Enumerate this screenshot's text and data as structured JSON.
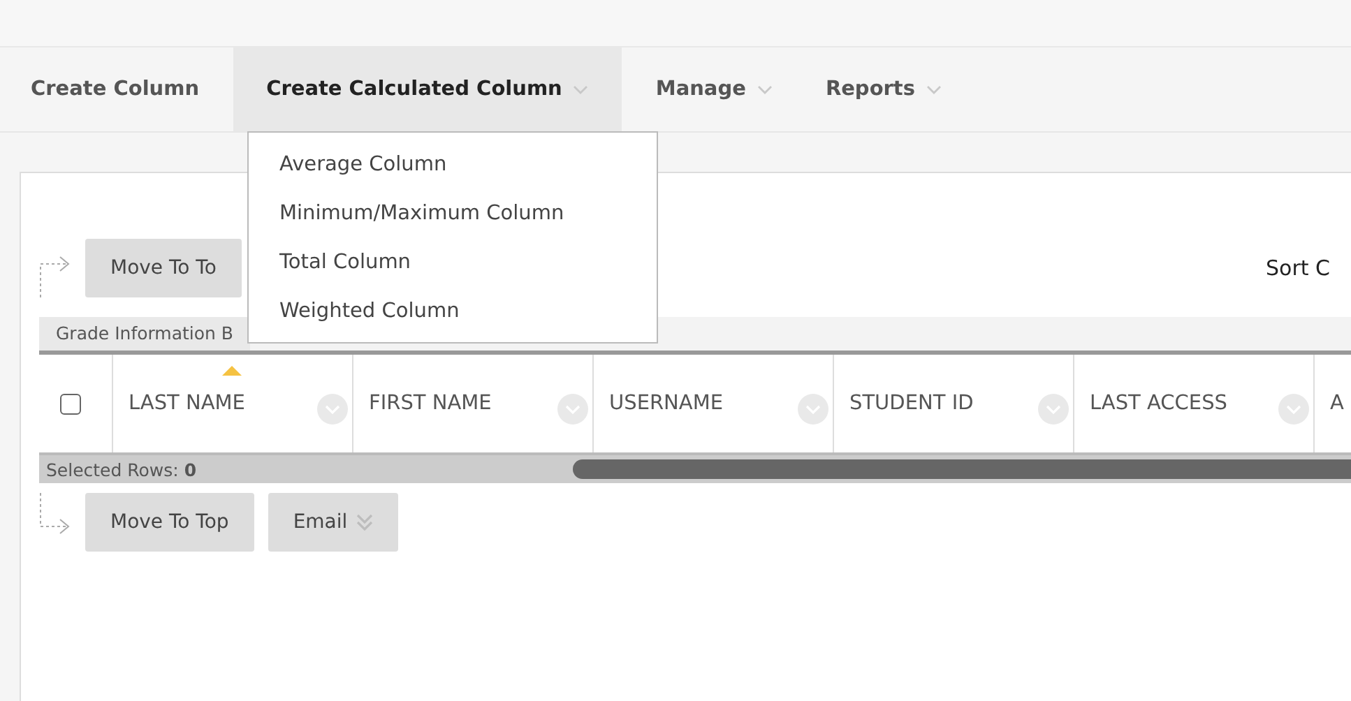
{
  "nav": [
    {
      "label": "Create Column",
      "selected": false,
      "caret": false
    },
    {
      "label": "Create Calculated Column",
      "selected": true,
      "caret": true
    },
    {
      "label": "Manage",
      "selected": false,
      "caret": true
    },
    {
      "label": "Reports",
      "selected": false,
      "caret": true
    }
  ],
  "menu": {
    "items": [
      "Average Column",
      "Minimum/Maximum Column",
      "Total Column",
      "Weighted Column"
    ]
  },
  "top_actions": {
    "buttons": [
      "Move To To"
    ],
    "sort_label": "Sort C"
  },
  "grade_info": "Grade Information B",
  "table": {
    "select_all_checked": false,
    "columns": [
      {
        "label": "LAST NAME",
        "sorted": true
      },
      {
        "label": "FIRST NAME",
        "sorted": false
      },
      {
        "label": "USERNAME",
        "sorted": false
      },
      {
        "label": "STUDENT ID",
        "sorted": false
      },
      {
        "label": "LAST ACCESS",
        "sorted": false
      },
      {
        "label": "A",
        "sorted": false
      }
    ]
  },
  "selected_rows": {
    "label": "Selected Rows:",
    "count": "0"
  },
  "bottom_actions": [
    {
      "label": "Move To Top",
      "caret": false
    },
    {
      "label": "Email",
      "caret": true
    }
  ]
}
